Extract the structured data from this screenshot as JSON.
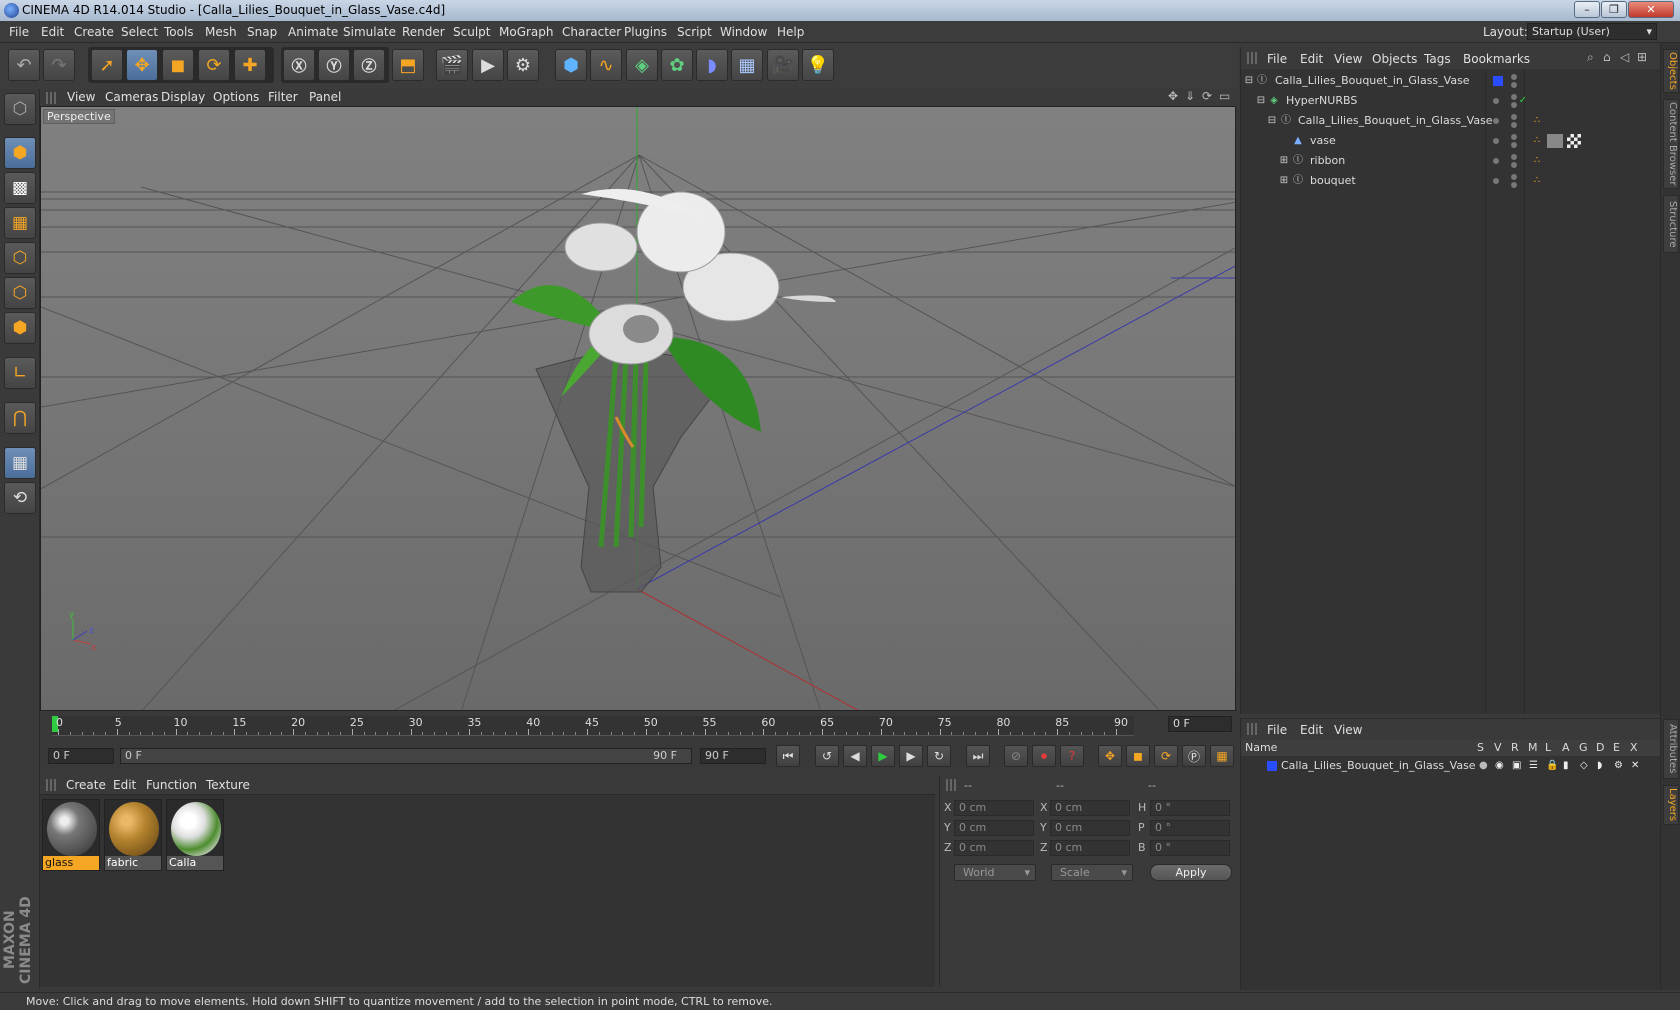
{
  "window": {
    "title": "CINEMA 4D R14.014 Studio - [Calla_Lilies_Bouquet_in_Glass_Vase.c4d]",
    "minimize": "–",
    "maximize": "❐",
    "close": "✕"
  },
  "menu": [
    "File",
    "Edit",
    "Create",
    "Select",
    "Tools",
    "Mesh",
    "Snap",
    "Animate",
    "Simulate",
    "Render",
    "Sculpt",
    "MoGraph",
    "Character",
    "Plugins",
    "Script",
    "Window",
    "Help"
  ],
  "layout": {
    "label": "Layout:",
    "value": "Startup (User)"
  },
  "viewport": {
    "menu": [
      "View",
      "Cameras",
      "Display",
      "Options",
      "Filter",
      "Panel"
    ],
    "label": "Perspective",
    "axis_x": "x",
    "axis_y": "y",
    "axis_z": "z"
  },
  "timeline": {
    "ticks": [
      "0",
      "5",
      "10",
      "15",
      "20",
      "25",
      "30",
      "35",
      "40",
      "45",
      "50",
      "55",
      "60",
      "65",
      "70",
      "75",
      "80",
      "85",
      "90"
    ],
    "current_frame": "0 F",
    "start_field": "0 F",
    "slider_start": "0 F",
    "slider_end": "90 F",
    "end_field": "90 F"
  },
  "materials": {
    "menu": [
      "Create",
      "Edit",
      "Function",
      "Texture"
    ],
    "items": [
      {
        "name": "glass",
        "selected": true
      },
      {
        "name": "fabric",
        "selected": false
      },
      {
        "name": "Calla",
        "selected": false
      }
    ]
  },
  "coordinates": {
    "headers": [
      "--",
      "--",
      "--"
    ],
    "rows": [
      {
        "l1": "X",
        "v1": "0 cm",
        "l2": "X",
        "v2": "0 cm",
        "l3": "H",
        "v3": "0 °"
      },
      {
        "l1": "Y",
        "v1": "0 cm",
        "l2": "Y",
        "v2": "0 cm",
        "l3": "P",
        "v3": "0 °"
      },
      {
        "l1": "Z",
        "v1": "0 cm",
        "l2": "Z",
        "v2": "0 cm",
        "l3": "B",
        "v3": "0 °"
      }
    ],
    "mode": "World",
    "type": "Scale",
    "apply": "Apply"
  },
  "objects": {
    "menu": [
      "File",
      "Edit",
      "View",
      "Objects",
      "Tags",
      "Bookmarks"
    ],
    "rows": [
      {
        "name": "Calla_Lilies_Bouquet_in_Glass_Vase",
        "expander": "⊟"
      },
      {
        "name": "HyperNURBS",
        "expander": "⊟"
      },
      {
        "name": "Calla_Lilies_Bouquet_in_Glass_Vase",
        "expander": "⊟"
      },
      {
        "name": "vase",
        "expander": ""
      },
      {
        "name": "ribbon",
        "expander": "⊞"
      },
      {
        "name": "bouquet",
        "expander": "⊞"
      }
    ]
  },
  "layers": {
    "menu": [
      "File",
      "Edit",
      "View"
    ],
    "name_col": "Name",
    "cols": [
      "S",
      "V",
      "R",
      "M",
      "L",
      "A",
      "G",
      "D",
      "E",
      "X"
    ],
    "rows": [
      {
        "name": "Calla_Lilies_Bouquet_in_Glass_Vase"
      }
    ]
  },
  "side_tabs": [
    "Objects",
    "Content Browser",
    "Structure",
    "Attributes",
    "Layers"
  ],
  "branding": "MAXON CINEMA 4D",
  "status": "Move: Click and drag to move elements. Hold down SHIFT to quantize movement / add to the selection in point mode, CTRL to remove.",
  "colors": {
    "accent": "#f5a623",
    "selection": "#4a6d9a",
    "layer_color": "#2a4cff"
  }
}
